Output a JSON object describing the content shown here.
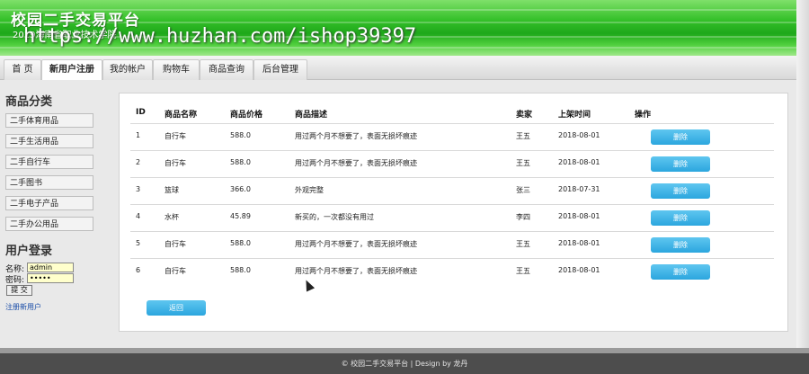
{
  "header": {
    "title": "校园二手交易平台",
    "subtitle": "2019海南省职业技术学院",
    "watermark": "https://www.huzhan.com/ishop39397"
  },
  "nav": {
    "items": [
      {
        "label": "首 页"
      },
      {
        "label": "新用户注册"
      },
      {
        "label": "我的帐户"
      },
      {
        "label": "购物车"
      },
      {
        "label": "商品查询"
      },
      {
        "label": "后台管理"
      }
    ],
    "active": "新用户注册"
  },
  "sidebar": {
    "category_title": "商品分类",
    "categories": [
      "二手体育用品",
      "二手生活用品",
      "二手自行车",
      "二手图书",
      "二手电子产品",
      "二手办公用品"
    ],
    "login_title": "用户登录",
    "name_label": "名称:",
    "name_value": "admin",
    "password_label": "密码:",
    "password_value": "•••••",
    "submit_label": "提 交",
    "register_label": "注册新用户"
  },
  "table": {
    "headers": [
      "ID",
      "商品名称",
      "商品价格",
      "商品描述",
      "卖家",
      "上架时间",
      "操作"
    ],
    "rows": [
      {
        "id": "1",
        "name": "自行车",
        "price": "588.0",
        "desc": "用过两个月不想要了，表面无损坏痕迹",
        "seller": "王五",
        "date": "2018-08-01",
        "action": "删除"
      },
      {
        "id": "2",
        "name": "自行车",
        "price": "588.0",
        "desc": "用过两个月不想要了，表面无损坏痕迹",
        "seller": "王五",
        "date": "2018-08-01",
        "action": "删除"
      },
      {
        "id": "3",
        "name": "篮球",
        "price": "366.0",
        "desc": "外观完整",
        "seller": "张三",
        "date": "2018-07-31",
        "action": "删除"
      },
      {
        "id": "4",
        "name": "水杯",
        "price": "45.89",
        "desc": "新买的，一次都没有用过",
        "seller": "李四",
        "date": "2018-08-01",
        "action": "删除"
      },
      {
        "id": "5",
        "name": "自行车",
        "price": "588.0",
        "desc": "用过两个月不想要了，表面无损坏痕迹",
        "seller": "王五",
        "date": "2018-08-01",
        "action": "删除"
      },
      {
        "id": "6",
        "name": "自行车",
        "price": "588.0",
        "desc": "用过两个月不想要了，表面无损坏痕迹",
        "seller": "王五",
        "date": "2018-08-01",
        "action": "删除"
      }
    ],
    "back_label": "返回"
  },
  "footer": {
    "text": "© 校园二手交易平台 | Design by 龙丹"
  },
  "colors": {
    "header_green": "#1ea81a",
    "button_blue": "#2ba6de",
    "footer_bg": "#4d4d4d"
  }
}
